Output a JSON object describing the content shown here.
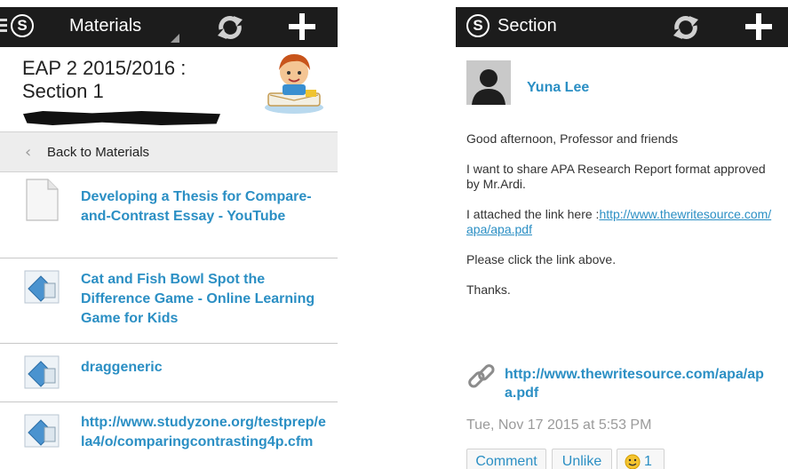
{
  "left_screen": {
    "top_bar": {
      "title": "Materials"
    },
    "course": {
      "title": "EAP 2 2015/2016 : Section 1"
    },
    "back_link": "Back to Materials",
    "materials": [
      {
        "title": "Developing a Thesis for Compare-and-Contrast Essay - YouTube",
        "icon": "document-icon"
      },
      {
        "title": "Cat and Fish Bowl Spot the Difference Game - Online Learning Game for Kids",
        "icon": "web-link-icon"
      },
      {
        "title": "draggeneric",
        "icon": "web-link-icon"
      },
      {
        "title": "http://www.studyzone.org/testprep/ela4/o/comparingcontrasting4p.cfm",
        "icon": "web-link-icon"
      }
    ]
  },
  "right_screen": {
    "top_bar": {
      "title": "Section"
    },
    "post": {
      "author": "Yuna Lee",
      "greeting": "Good afternoon, Professor and friends",
      "line1": "I want to share APA Research Report format approved by Mr.Ardi.",
      "line2_prefix": "I attached the link here :",
      "line2_link": "http://www.thewritesource.com/apa/apa.pdf",
      "line3": "Please click the link above.",
      "line4": "Thanks.",
      "attachment_link": "http://www.thewritesource.com/apa/apa.pdf",
      "timestamp": "Tue, Nov 17 2015 at 5:53 PM"
    },
    "actions": {
      "comment": "Comment",
      "unlike": "Unlike",
      "like_count": "1"
    }
  },
  "colors": {
    "top_bar": "#1c1c1c",
    "link_blue": "#2b8fc4",
    "back_row": "#ededed",
    "divider": "#c8c8c8"
  }
}
